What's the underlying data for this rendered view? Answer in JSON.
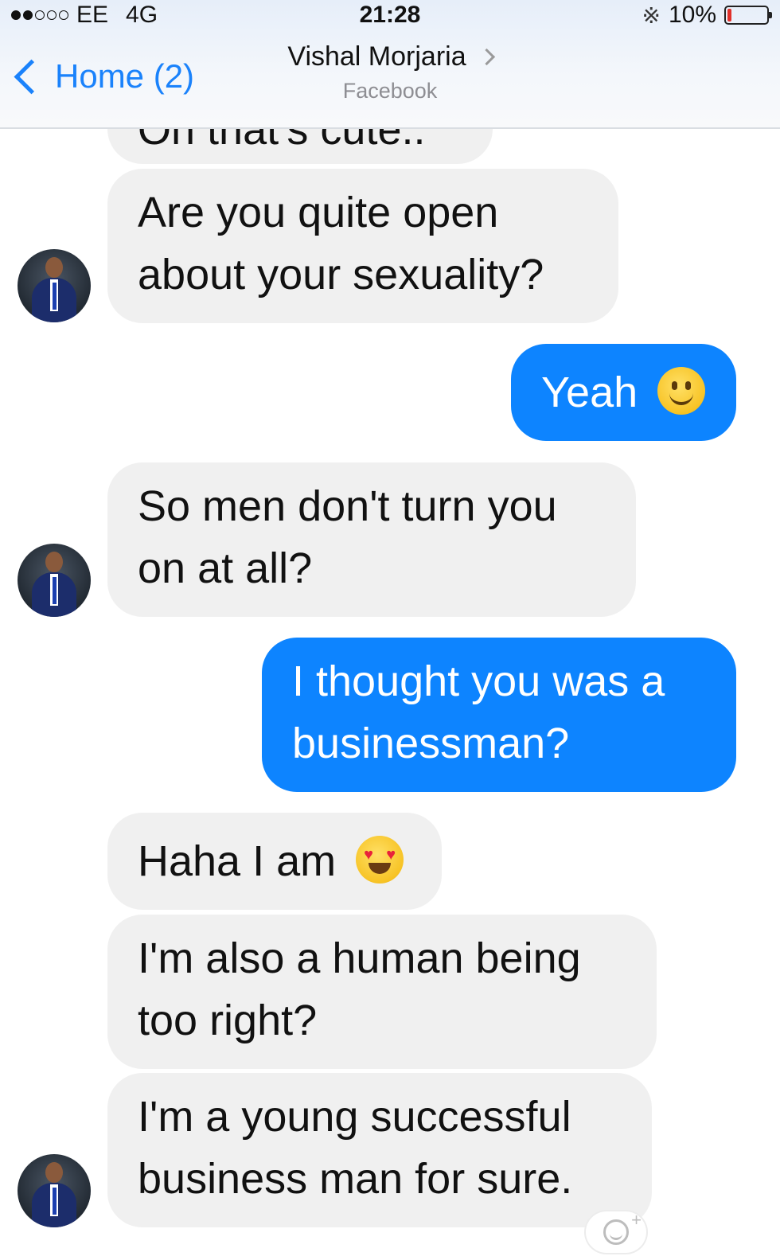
{
  "status_bar": {
    "carrier": "EE",
    "network": "4G",
    "time": "21:28",
    "battery_percent": "10%",
    "battery_level": 0.1
  },
  "nav": {
    "back_label": "Home (2)",
    "contact_name": "Vishal Morjaria",
    "contact_subtitle": "Facebook"
  },
  "messages": [
    {
      "direction": "incoming",
      "text": "Oh that's cute..",
      "partial": true
    },
    {
      "direction": "incoming",
      "lines": [
        "Are you quite open",
        "about your sexuality?"
      ]
    },
    {
      "direction": "outgoing",
      "text": "Yeah",
      "emoji": "slightly-smiling-face"
    },
    {
      "direction": "incoming",
      "lines": [
        "So men don't turn you",
        "on at all?"
      ]
    },
    {
      "direction": "outgoing",
      "lines": [
        "I thought you was a",
        "businessman?"
      ]
    },
    {
      "direction": "incoming",
      "text": "Haha I am",
      "emoji": "heart-eyes-face"
    },
    {
      "direction": "incoming",
      "lines": [
        "I'm also a human being",
        "too right?"
      ]
    },
    {
      "direction": "incoming",
      "lines": [
        "I'm a young successful",
        "business man for sure."
      ]
    }
  ],
  "colors": {
    "outgoing_bubble": "#0d84ff",
    "incoming_bubble": "#f0f0f0",
    "accent": "#1a82fb"
  }
}
